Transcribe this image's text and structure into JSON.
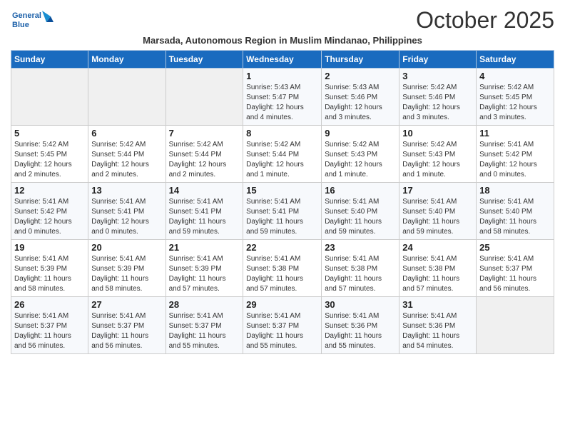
{
  "logo": {
    "line1": "General",
    "line2": "Blue"
  },
  "title": "October 2025",
  "subtitle": "Marsada, Autonomous Region in Muslim Mindanao, Philippines",
  "headers": [
    "Sunday",
    "Monday",
    "Tuesday",
    "Wednesday",
    "Thursday",
    "Friday",
    "Saturday"
  ],
  "weeks": [
    [
      {
        "day": "",
        "info": ""
      },
      {
        "day": "",
        "info": ""
      },
      {
        "day": "",
        "info": ""
      },
      {
        "day": "1",
        "info": "Sunrise: 5:43 AM\nSunset: 5:47 PM\nDaylight: 12 hours\nand 4 minutes."
      },
      {
        "day": "2",
        "info": "Sunrise: 5:43 AM\nSunset: 5:46 PM\nDaylight: 12 hours\nand 3 minutes."
      },
      {
        "day": "3",
        "info": "Sunrise: 5:42 AM\nSunset: 5:46 PM\nDaylight: 12 hours\nand 3 minutes."
      },
      {
        "day": "4",
        "info": "Sunrise: 5:42 AM\nSunset: 5:45 PM\nDaylight: 12 hours\nand 3 minutes."
      }
    ],
    [
      {
        "day": "5",
        "info": "Sunrise: 5:42 AM\nSunset: 5:45 PM\nDaylight: 12 hours\nand 2 minutes."
      },
      {
        "day": "6",
        "info": "Sunrise: 5:42 AM\nSunset: 5:44 PM\nDaylight: 12 hours\nand 2 minutes."
      },
      {
        "day": "7",
        "info": "Sunrise: 5:42 AM\nSunset: 5:44 PM\nDaylight: 12 hours\nand 2 minutes."
      },
      {
        "day": "8",
        "info": "Sunrise: 5:42 AM\nSunset: 5:44 PM\nDaylight: 12 hours\nand 1 minute."
      },
      {
        "day": "9",
        "info": "Sunrise: 5:42 AM\nSunset: 5:43 PM\nDaylight: 12 hours\nand 1 minute."
      },
      {
        "day": "10",
        "info": "Sunrise: 5:42 AM\nSunset: 5:43 PM\nDaylight: 12 hours\nand 1 minute."
      },
      {
        "day": "11",
        "info": "Sunrise: 5:41 AM\nSunset: 5:42 PM\nDaylight: 12 hours\nand 0 minutes."
      }
    ],
    [
      {
        "day": "12",
        "info": "Sunrise: 5:41 AM\nSunset: 5:42 PM\nDaylight: 12 hours\nand 0 minutes."
      },
      {
        "day": "13",
        "info": "Sunrise: 5:41 AM\nSunset: 5:41 PM\nDaylight: 12 hours\nand 0 minutes."
      },
      {
        "day": "14",
        "info": "Sunrise: 5:41 AM\nSunset: 5:41 PM\nDaylight: 11 hours\nand 59 minutes."
      },
      {
        "day": "15",
        "info": "Sunrise: 5:41 AM\nSunset: 5:41 PM\nDaylight: 11 hours\nand 59 minutes."
      },
      {
        "day": "16",
        "info": "Sunrise: 5:41 AM\nSunset: 5:40 PM\nDaylight: 11 hours\nand 59 minutes."
      },
      {
        "day": "17",
        "info": "Sunrise: 5:41 AM\nSunset: 5:40 PM\nDaylight: 11 hours\nand 59 minutes."
      },
      {
        "day": "18",
        "info": "Sunrise: 5:41 AM\nSunset: 5:40 PM\nDaylight: 11 hours\nand 58 minutes."
      }
    ],
    [
      {
        "day": "19",
        "info": "Sunrise: 5:41 AM\nSunset: 5:39 PM\nDaylight: 11 hours\nand 58 minutes."
      },
      {
        "day": "20",
        "info": "Sunrise: 5:41 AM\nSunset: 5:39 PM\nDaylight: 11 hours\nand 58 minutes."
      },
      {
        "day": "21",
        "info": "Sunrise: 5:41 AM\nSunset: 5:39 PM\nDaylight: 11 hours\nand 57 minutes."
      },
      {
        "day": "22",
        "info": "Sunrise: 5:41 AM\nSunset: 5:38 PM\nDaylight: 11 hours\nand 57 minutes."
      },
      {
        "day": "23",
        "info": "Sunrise: 5:41 AM\nSunset: 5:38 PM\nDaylight: 11 hours\nand 57 minutes."
      },
      {
        "day": "24",
        "info": "Sunrise: 5:41 AM\nSunset: 5:38 PM\nDaylight: 11 hours\nand 57 minutes."
      },
      {
        "day": "25",
        "info": "Sunrise: 5:41 AM\nSunset: 5:37 PM\nDaylight: 11 hours\nand 56 minutes."
      }
    ],
    [
      {
        "day": "26",
        "info": "Sunrise: 5:41 AM\nSunset: 5:37 PM\nDaylight: 11 hours\nand 56 minutes."
      },
      {
        "day": "27",
        "info": "Sunrise: 5:41 AM\nSunset: 5:37 PM\nDaylight: 11 hours\nand 56 minutes."
      },
      {
        "day": "28",
        "info": "Sunrise: 5:41 AM\nSunset: 5:37 PM\nDaylight: 11 hours\nand 55 minutes."
      },
      {
        "day": "29",
        "info": "Sunrise: 5:41 AM\nSunset: 5:37 PM\nDaylight: 11 hours\nand 55 minutes."
      },
      {
        "day": "30",
        "info": "Sunrise: 5:41 AM\nSunset: 5:36 PM\nDaylight: 11 hours\nand 55 minutes."
      },
      {
        "day": "31",
        "info": "Sunrise: 5:41 AM\nSunset: 5:36 PM\nDaylight: 11 hours\nand 54 minutes."
      },
      {
        "day": "",
        "info": ""
      }
    ]
  ]
}
